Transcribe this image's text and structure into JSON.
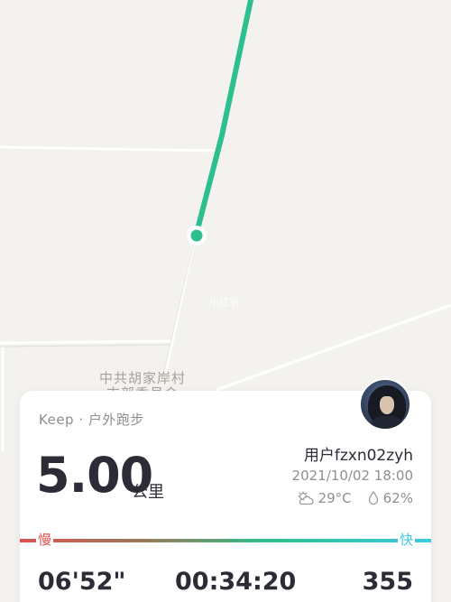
{
  "map": {
    "place_label_line1": "中共胡家岸村",
    "place_label_line2": "支部委员会",
    "watermark": "小红书",
    "route_color": "#2dbf8f"
  },
  "card": {
    "activity": "Keep · 户外跑步",
    "distance": "5.00",
    "unit": "公里",
    "username": "用户fzxn02zyh",
    "datetime": "2021/10/02 18:00",
    "temperature": "29°C",
    "humidity": "62%",
    "weather_icon": "partly-cloudy-icon",
    "humidity_icon": "droplet-icon",
    "slow_label": "慢",
    "fast_label": "快",
    "pace": "06'52\"",
    "duration": "00:34:20",
    "calories": "355"
  }
}
